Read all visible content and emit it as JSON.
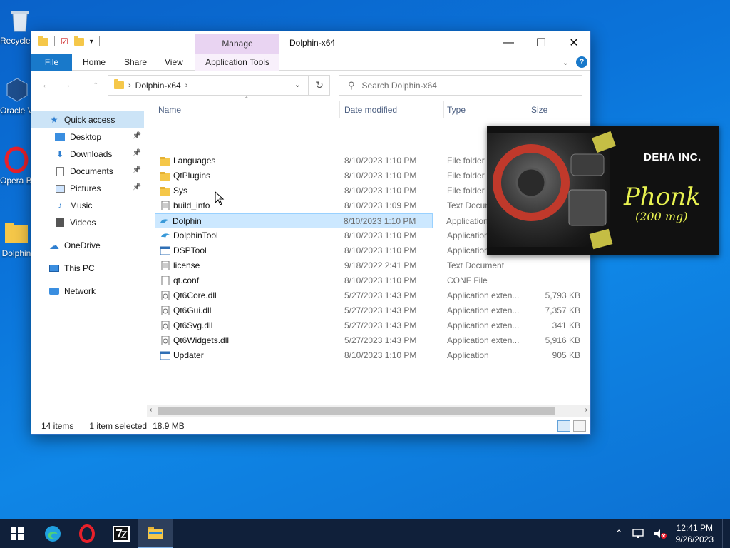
{
  "desktop": {
    "icons": [
      {
        "label": "Recycle Bin"
      },
      {
        "label": "Oracle VM VirtualBox"
      },
      {
        "label": "Opera Browser"
      },
      {
        "label": "Dolphin"
      }
    ]
  },
  "window": {
    "title": "Dolphin-x64",
    "manage_tab": "Manage",
    "ribbon_tabs": [
      "File",
      "Home",
      "Share",
      "View",
      "Application Tools"
    ],
    "address": {
      "folder": "Dolphin-x64"
    },
    "search_placeholder": "Search Dolphin-x64",
    "columns": {
      "name": "Name",
      "date": "Date modified",
      "type": "Type",
      "size": "Size"
    },
    "sidebar": [
      {
        "label": "Quick access",
        "icon": "star-icon",
        "level": 0,
        "selected": true
      },
      {
        "label": "Desktop",
        "icon": "desktop-icon",
        "level": 1,
        "pinned": true
      },
      {
        "label": "Downloads",
        "icon": "download-icon",
        "level": 1,
        "pinned": true
      },
      {
        "label": "Documents",
        "icon": "document-icon",
        "level": 1,
        "pinned": true
      },
      {
        "label": "Pictures",
        "icon": "picture-icon",
        "level": 1,
        "pinned": true
      },
      {
        "label": "Music",
        "icon": "music-icon",
        "level": 1
      },
      {
        "label": "Videos",
        "icon": "video-icon",
        "level": 1
      },
      {
        "label": "OneDrive",
        "icon": "cloud-icon",
        "level": 0
      },
      {
        "label": "This PC",
        "icon": "computer-icon",
        "level": 0
      },
      {
        "label": "Network",
        "icon": "network-icon",
        "level": 0
      }
    ],
    "files": [
      {
        "name": "Languages",
        "date": "8/10/2023 1:10 PM",
        "type": "File folder",
        "size": "",
        "kind": "folder"
      },
      {
        "name": "QtPlugins",
        "date": "8/10/2023 1:10 PM",
        "type": "File folder",
        "size": "",
        "kind": "folder"
      },
      {
        "name": "Sys",
        "date": "8/10/2023 1:10 PM",
        "type": "File folder",
        "size": "",
        "kind": "folder"
      },
      {
        "name": "build_info",
        "date": "8/10/2023 1:09 PM",
        "type": "Text Document",
        "size": "",
        "kind": "text"
      },
      {
        "name": "Dolphin",
        "date": "8/10/2023 1:10 PM",
        "type": "Application",
        "size": "",
        "kind": "dolphin",
        "selected": true
      },
      {
        "name": "DolphinTool",
        "date": "8/10/2023 1:10 PM",
        "type": "Application",
        "size": "",
        "kind": "dolphin"
      },
      {
        "name": "DSPTool",
        "date": "8/10/2023 1:10 PM",
        "type": "Application",
        "size": "",
        "kind": "app"
      },
      {
        "name": "license",
        "date": "9/18/2022 2:41 PM",
        "type": "Text Document",
        "size": "",
        "kind": "text"
      },
      {
        "name": "qt.conf",
        "date": "8/10/2023 1:10 PM",
        "type": "CONF File",
        "size": "",
        "kind": "blank"
      },
      {
        "name": "Qt6Core.dll",
        "date": "5/27/2023 1:43 PM",
        "type": "Application exten...",
        "size": "5,793 KB",
        "kind": "dll"
      },
      {
        "name": "Qt6Gui.dll",
        "date": "5/27/2023 1:43 PM",
        "type": "Application exten...",
        "size": "7,357 KB",
        "kind": "dll"
      },
      {
        "name": "Qt6Svg.dll",
        "date": "5/27/2023 1:43 PM",
        "type": "Application exten...",
        "size": "341 KB",
        "kind": "dll"
      },
      {
        "name": "Qt6Widgets.dll",
        "date": "5/27/2023 1:43 PM",
        "type": "Application exten...",
        "size": "5,916 KB",
        "kind": "dll"
      },
      {
        "name": "Updater",
        "date": "8/10/2023 1:10 PM",
        "type": "Application",
        "size": "905 KB",
        "kind": "app"
      }
    ],
    "status": {
      "count": "14 items",
      "selection": "1 item selected",
      "size": "18.9 MB"
    }
  },
  "overlay": {
    "brand": "DEHA INC.",
    "title": "Phonk",
    "subtitle": "(200 mg)"
  },
  "taskbar": {
    "time": "12:41 PM",
    "date": "9/26/2023",
    "apps": [
      "windows-start-icon",
      "edge-icon",
      "opera-icon",
      "7zip-icon",
      "file-explorer-icon"
    ]
  }
}
